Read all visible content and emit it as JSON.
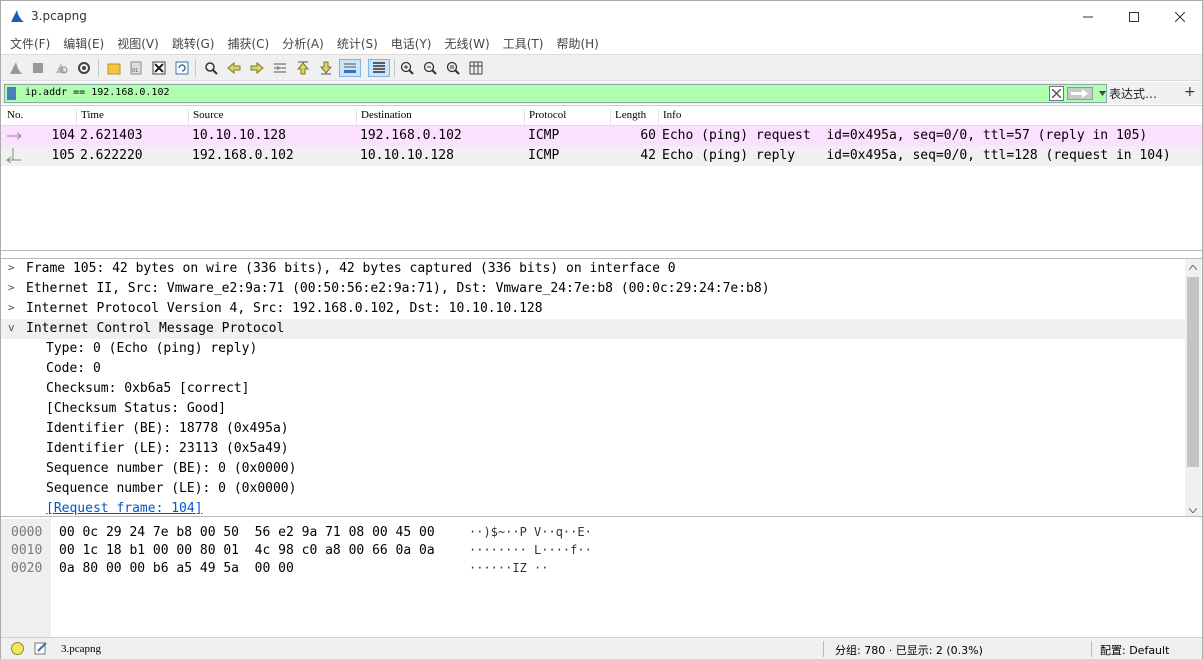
{
  "window": {
    "title": "3.pcapng"
  },
  "menu": [
    "文件(F)",
    "编辑(E)",
    "视图(V)",
    "跳转(G)",
    "捕获(C)",
    "分析(A)",
    "统计(S)",
    "电话(Y)",
    "无线(W)",
    "工具(T)",
    "帮助(H)"
  ],
  "filter": {
    "value": "ip.addr == 192.168.0.102",
    "expression_label": "表达式…",
    "add_label": "+"
  },
  "packet_list": {
    "columns": [
      "No.",
      "Time",
      "Source",
      "Destination",
      "Protocol",
      "Length",
      "Info"
    ],
    "rows": [
      {
        "no": "104",
        "time": "2.621403",
        "source": "10.10.10.128",
        "destination": "192.168.0.102",
        "protocol": "ICMP",
        "length": "60",
        "info": "Echo (ping) request  id=0x495a, seq=0/0, ttl=57 (reply in 105)"
      },
      {
        "no": "105",
        "time": "2.622220",
        "source": "192.168.0.102",
        "destination": "10.10.10.128",
        "protocol": "ICMP",
        "length": "42",
        "info": "Echo (ping) reply    id=0x495a, seq=0/0, ttl=128 (request in 104)"
      }
    ]
  },
  "details": [
    {
      "text": "Frame 105: 42 bytes on wire (336 bits), 42 bytes captured (336 bits) on interface 0",
      "arrow": ">"
    },
    {
      "text": "Ethernet II, Src: Vmware_e2:9a:71 (00:50:56:e2:9a:71), Dst: Vmware_24:7e:b8 (00:0c:29:24:7e:b8)",
      "arrow": ">"
    },
    {
      "text": "Internet Protocol Version 4, Src: 192.168.0.102, Dst: 10.10.10.128",
      "arrow": ">"
    },
    {
      "text": "Internet Control Message Protocol",
      "arrow": "v"
    },
    {
      "text": "Type: 0 (Echo (ping) reply)"
    },
    {
      "text": "Code: 0"
    },
    {
      "text": "Checksum: 0xb6a5 [correct]"
    },
    {
      "text": "[Checksum Status: Good]"
    },
    {
      "text": "Identifier (BE): 18778 (0x495a)"
    },
    {
      "text": "Identifier (LE): 23113 (0x5a49)"
    },
    {
      "text": "Sequence number (BE): 0 (0x0000)"
    },
    {
      "text": "Sequence number (LE): 0 (0x0000)"
    },
    {
      "text": "[Request frame: 104]"
    }
  ],
  "bytes": [
    {
      "offset": "0000",
      "hex": "00 0c 29 24 7e b8 00 50  56 e2 9a 71 08 00 45 00",
      "ascii": "··)$~··P V··q··E·"
    },
    {
      "offset": "0010",
      "hex": "00 1c 18 b1 00 00 80 01  4c 98 c0 a8 00 66 0a 0a",
      "ascii": "········ L····f··"
    },
    {
      "offset": "0020",
      "hex": "0a 80 00 00 b6 a5 49 5a  00 00",
      "ascii": "······IZ ··"
    }
  ],
  "status": {
    "file": "3.pcapng",
    "packets": "分组: 780 · 已显示: 2 (0.3%)",
    "profile": "配置: Default"
  },
  "colors": {
    "filter_valid": "#afffaf",
    "icmp_row": "#fce0ff",
    "link": "#0055cc"
  }
}
